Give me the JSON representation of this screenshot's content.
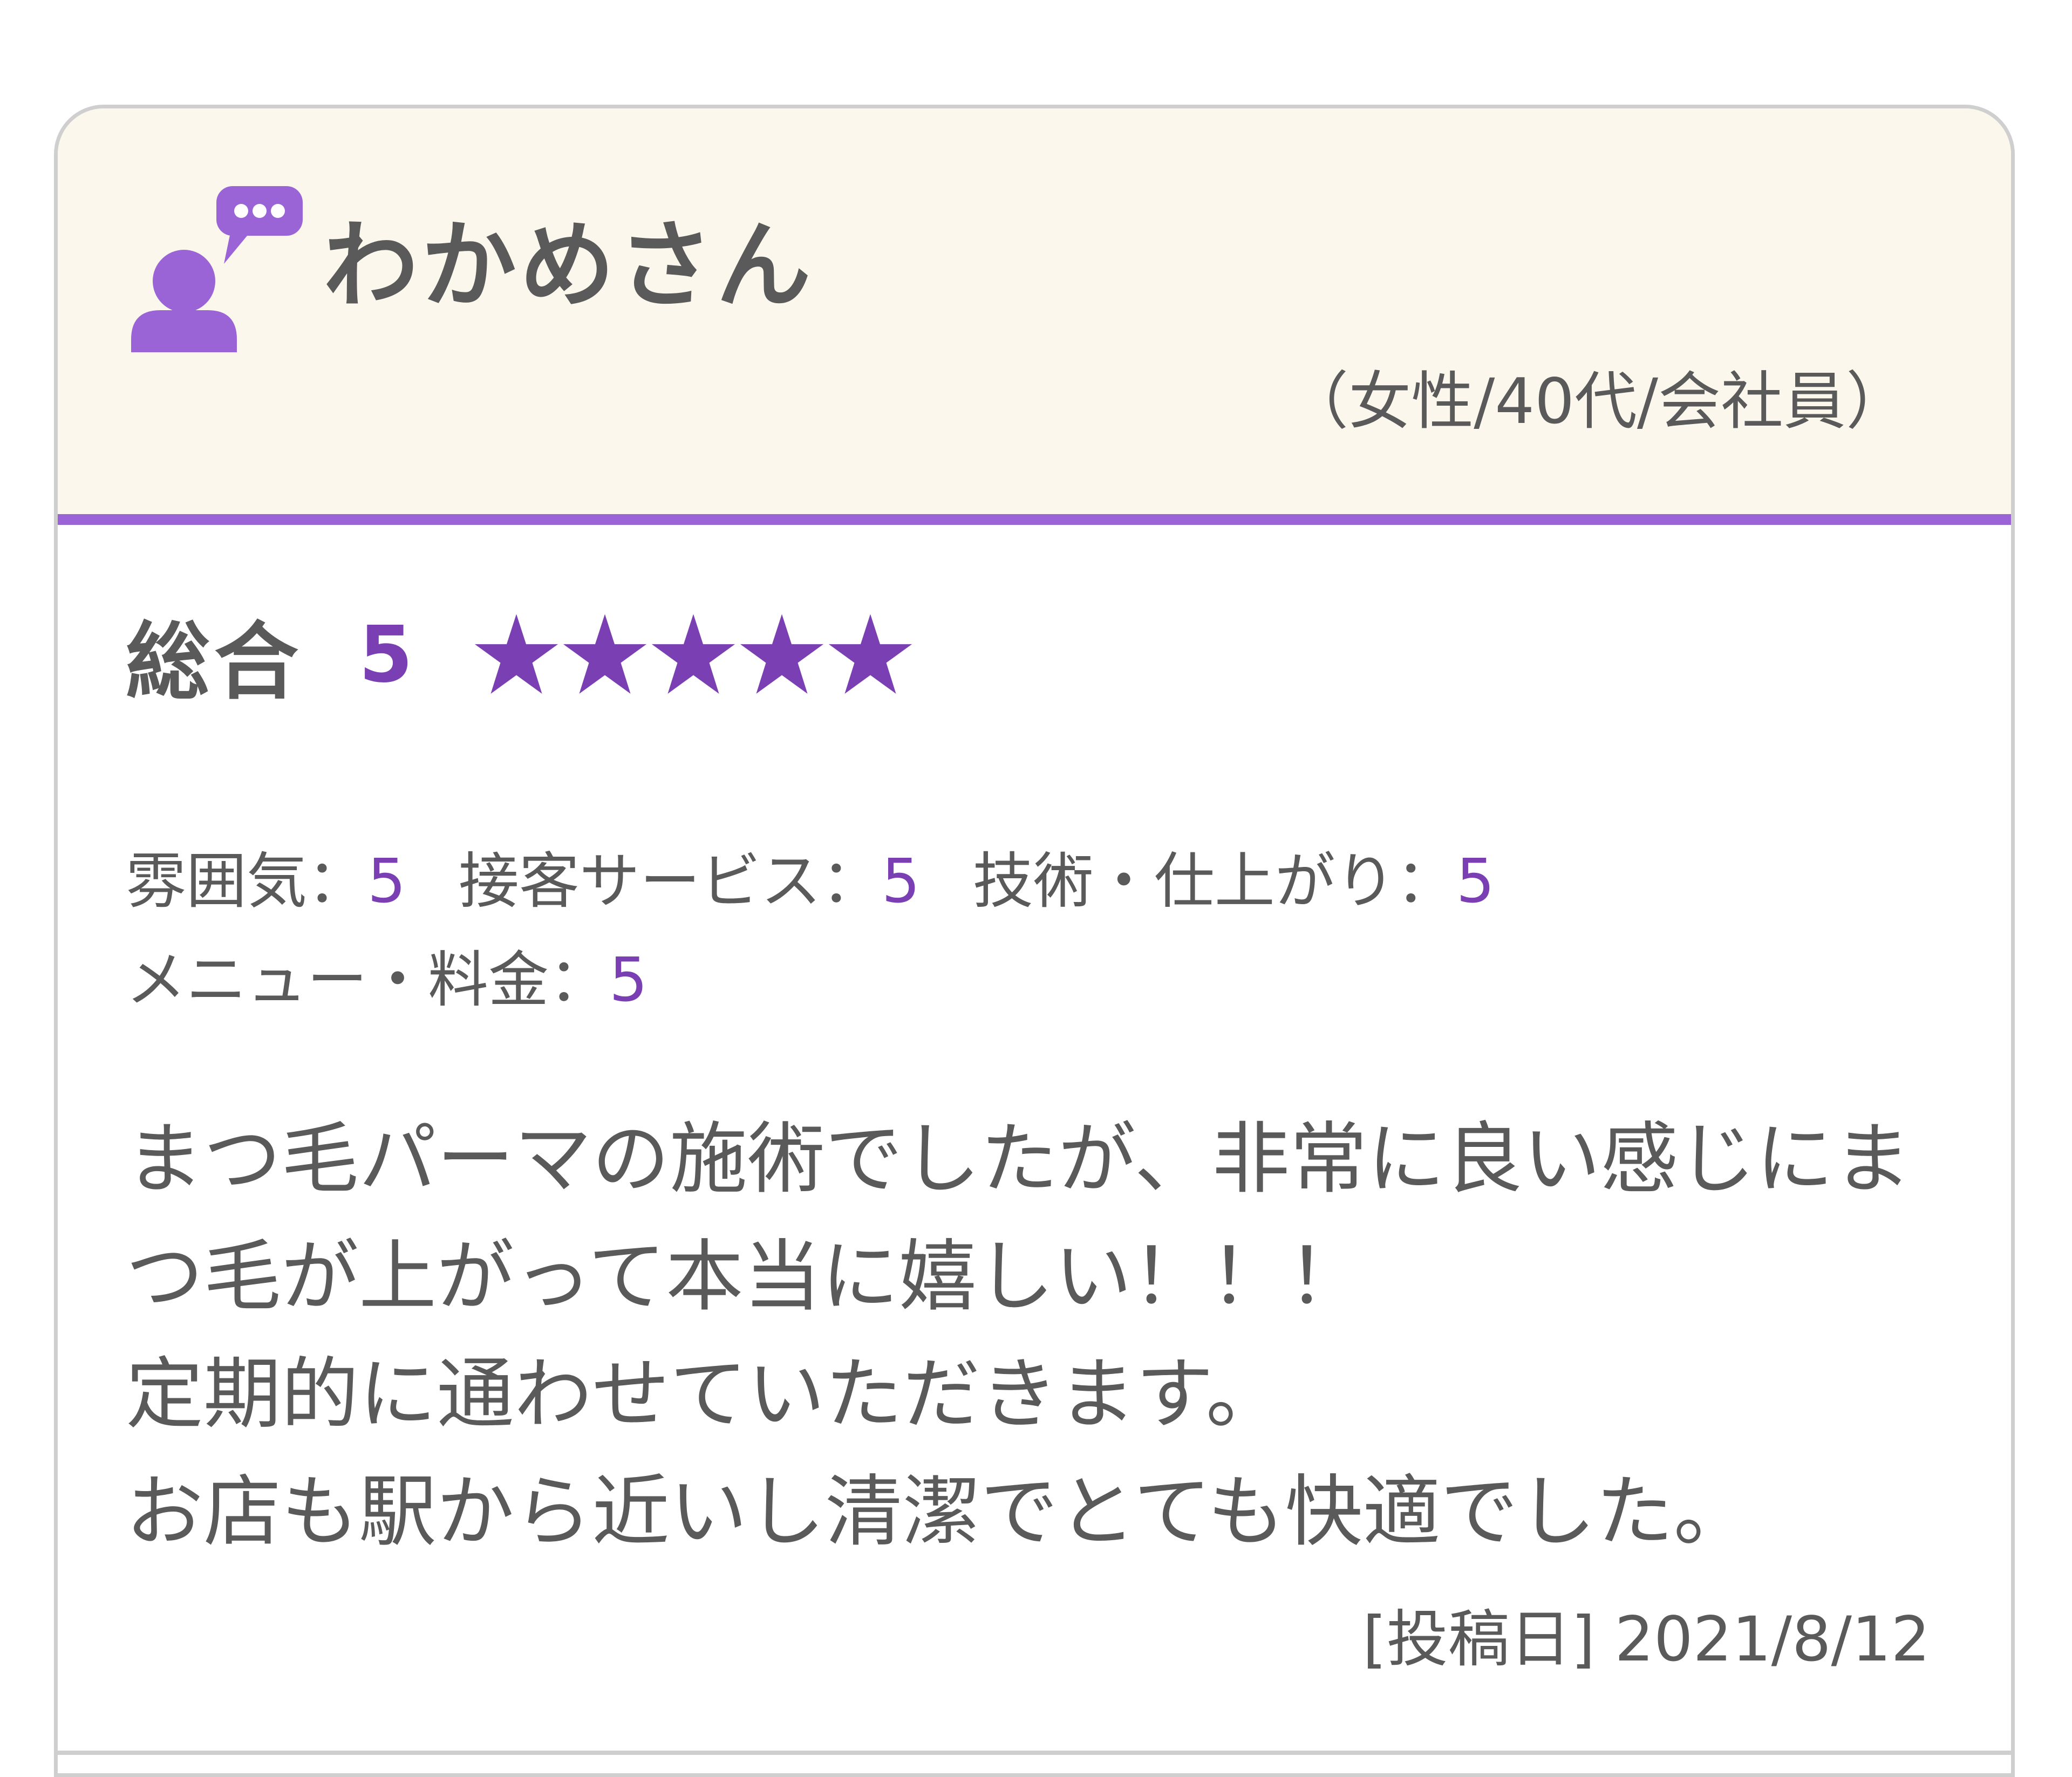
{
  "review": {
    "reviewer": {
      "name": "わかめさん",
      "meta": "（女性/40代/会社員）",
      "avatar_icon": "user-chat-icon"
    },
    "overall": {
      "label": "総合",
      "score": "5",
      "stars": 5,
      "max_stars": 5
    },
    "sub_ratings_row1": [
      {
        "label": "雰囲気：",
        "value": "5"
      },
      {
        "label": "接客サービス：",
        "value": "5"
      },
      {
        "label": "技術・仕上がり：",
        "value": "5"
      }
    ],
    "sub_ratings_row2": [
      {
        "label": "メニュー・料金：",
        "value": "5"
      }
    ],
    "comment_lines": [
      "まつ毛パーマの施術でしたが、非常に良い感じにま",
      "つ毛が上がって本当に嬉しい！！！",
      "定期的に通わせていただきます。",
      "お店も駅から近いし清潔でとても快適でした。"
    ],
    "post_date": "[投稿日] 2021/8/12"
  },
  "colors": {
    "accent": "#7b3fb4",
    "header_rule": "#9b64d6",
    "header_bg": "#fcf7ec",
    "text": "#5a5a5a",
    "border": "#cfcfcf"
  }
}
